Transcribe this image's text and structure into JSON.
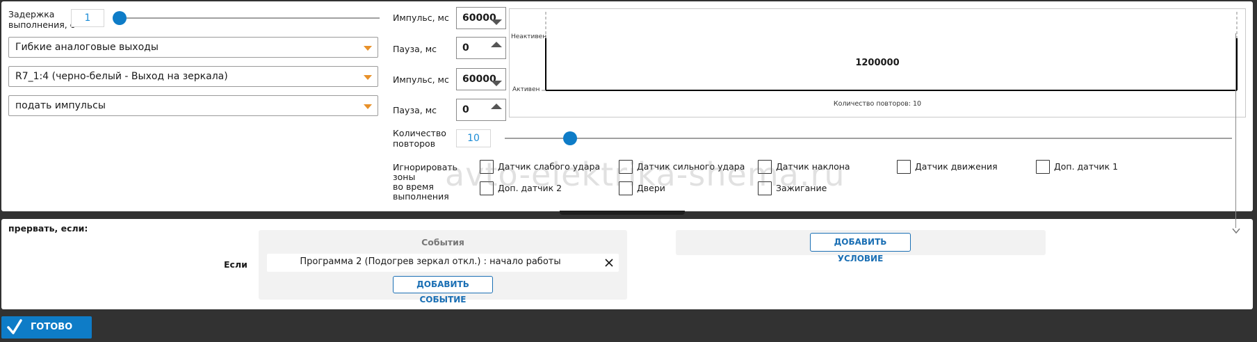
{
  "delay": {
    "label_line1": "Задержка",
    "label_line2": "выполнения, с",
    "value": "1"
  },
  "selects": [
    {
      "value": "Гибкие аналоговые выходы"
    },
    {
      "value": "R7_1:4 (черно-белый - Выход на зеркала)"
    },
    {
      "value": "подать импульсы"
    }
  ],
  "pulse_rows": [
    {
      "label": "Импульс, мс",
      "value": "60000"
    },
    {
      "label": "Пауза, мс",
      "value": "0"
    },
    {
      "label": "Импульс, мс",
      "value": "60000"
    },
    {
      "label": "Пауза, мс",
      "value": "0"
    }
  ],
  "graph": {
    "inactive_label": "Неактивен",
    "active_label": "Активен",
    "total": "1200000",
    "repeats_text": "Количество повторов: 10"
  },
  "repeats": {
    "label_line1": "Количество",
    "label_line2": "повторов",
    "value": "10",
    "level": 0.09
  },
  "ignore": {
    "label_line1": "Игнорировать зоны",
    "label_line2": "во время",
    "label_line3": "выполнения",
    "sensors": [
      "Датчик слабого удара",
      "Датчик сильного удара",
      "Датчик наклона",
      "Датчик движения",
      "Доп. датчик 1",
      "Доп. датчик 2",
      "Двери",
      "Зажигание"
    ]
  },
  "interrupt": {
    "title": "прервать, если:",
    "if_label": "Если",
    "events_header": "События",
    "event_text": "Программа 2 (Подогрев зеркал откл.) : начало работы",
    "add_event": "ДОБАВИТЬ СОБЫТИЕ",
    "add_condition": "ДОБАВИТЬ УСЛОВИЕ"
  },
  "done_button": "ГОТОВО",
  "watermark": "avto-elektrika-shema.ru",
  "colors": {
    "accent": "#0e7cc7",
    "caret": "#e8912a",
    "dark_bg": "#323232",
    "link": "#1a6fb4"
  }
}
